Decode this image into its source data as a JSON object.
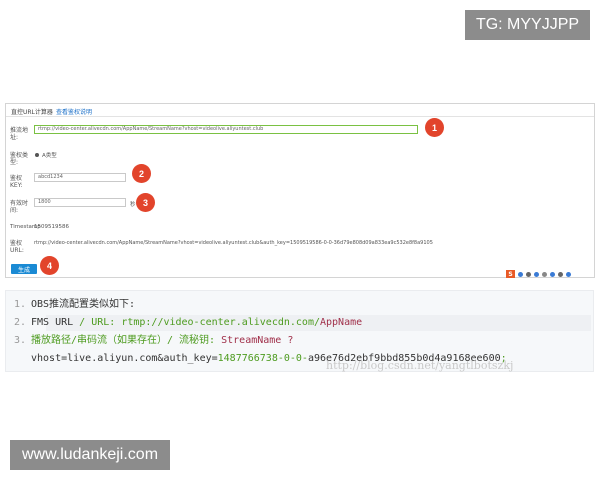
{
  "watermarks": {
    "top": "TG: MYYJJPP",
    "bottom": "www.ludankeji.com",
    "faint": "http://blog.csdn.net/yangtlbotszkj"
  },
  "screenshot": {
    "title": "直控URL计算器",
    "help_link": "查看鉴权说明",
    "fields": {
      "push_addr_label": "推流地址:",
      "push_addr_value": "rtmp://video-center.alivecdn.com/AppName/StreamName?vhost=videolive.aliyuntest.club",
      "auth_type_label": "鉴权类型:",
      "auth_type_value": "A类型",
      "auth_key_label": "鉴权KEY:",
      "auth_key_value": "abcd1234",
      "valid_time_label": "有效时间:",
      "valid_time_value": "1800",
      "valid_time_unit": "秒",
      "timestamp_label": "Timestamp",
      "timestamp_value": "1509519586",
      "auth_url_label": "鉴权URL:",
      "auth_url_value": "rtmp://video-center.alivecdn.com/AppName/StreamName?vhost=videolive.aliyuntest.club&auth_key=1509519586-0-0-36d79e808d09a833ea9c532e8f8a9105"
    },
    "generate_button": "生成",
    "step_numbers": [
      "1",
      "2",
      "3",
      "4"
    ],
    "tray_icon_label": "S"
  },
  "code_block": {
    "lines": [
      {
        "num": "1.",
        "parts": [
          {
            "t": "OBS推流配置类似如下:",
            "c": "c-text"
          }
        ]
      },
      {
        "num": "2.",
        "parts": [
          {
            "t": "FMS URL ",
            "c": "c-text"
          },
          {
            "t": "/ URL:  rtmp://video-center.alivecdn.com/",
            "c": "c-green"
          },
          {
            "t": "AppName",
            "c": "c-maroon"
          }
        ]
      },
      {
        "num": "3.",
        "parts": [
          {
            "t": "播放路径/串码流（如果存在）/ 流秘钥: ",
            "c": "c-green"
          },
          {
            "t": "StreamName ?",
            "c": "c-maroon"
          }
        ]
      },
      {
        "num": "",
        "parts": [
          {
            "t": "vhost=live.aliyun.com&auth_key=",
            "c": "c-text"
          },
          {
            "t": "1487766738-0-0-",
            "c": "c-green"
          },
          {
            "t": "a96e76d2ebf9bbd855b0d4a9168ee600",
            "c": "c-text"
          },
          {
            "t": ";",
            "c": "c-green"
          }
        ]
      }
    ]
  },
  "colors": {
    "step_badge": "#e2442b",
    "button": "#1a8ad4",
    "input_focus": "#7ac142",
    "code_bg": "#f6f8fa"
  }
}
